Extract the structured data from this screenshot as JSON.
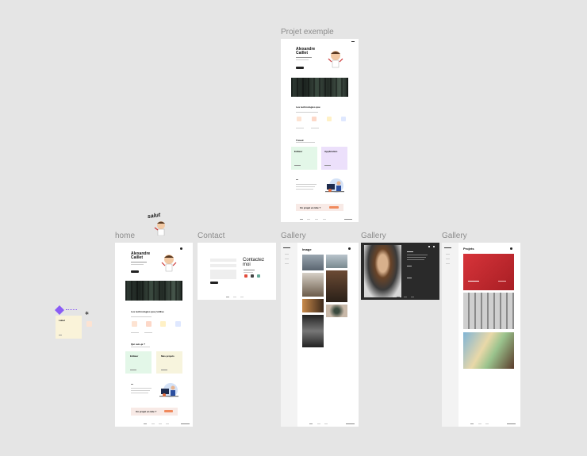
{
  "frames": {
    "projet": {
      "title": "Projet exemple",
      "name": "Alexandre",
      "surname": "Caillet",
      "section_skills": "Les technologies que",
      "section_travail": "Travail",
      "card1": "Editeur",
      "card2": "Application",
      "cta": "Un projet en tête ?"
    },
    "home": {
      "title": "home",
      "name": "Alexandre",
      "surname": "Caillet",
      "section_skills": "Les technologies que j'utilise",
      "section_travail": "Qui suis-je ?",
      "card1": "Editeur",
      "card2": "Mes projets",
      "cta": "Un projet en tête ?"
    },
    "contact": {
      "title": "Contact",
      "heading_line1": "Contactez",
      "heading_line2": "moi"
    },
    "gallery1": {
      "title": "Gallery",
      "heading": "Image"
    },
    "gallery2": {
      "title": "Gallery"
    },
    "gallery3": {
      "title": "Gallery",
      "heading": "Projets"
    }
  },
  "sticker": {
    "text": "salut"
  },
  "component": {
    "label": "Label"
  },
  "colors": {
    "canvas": "#e5e5e5",
    "frame": "#ffffff",
    "green_card": "#e3f7e8",
    "yellow_card": "#f7f4dd",
    "purple_card": "#ece0fb",
    "cta_bg": "#f8eae6",
    "cta_btn": "#f08a5d",
    "component_purple": "#8a5cf5",
    "projects_red": "#c8262c"
  }
}
